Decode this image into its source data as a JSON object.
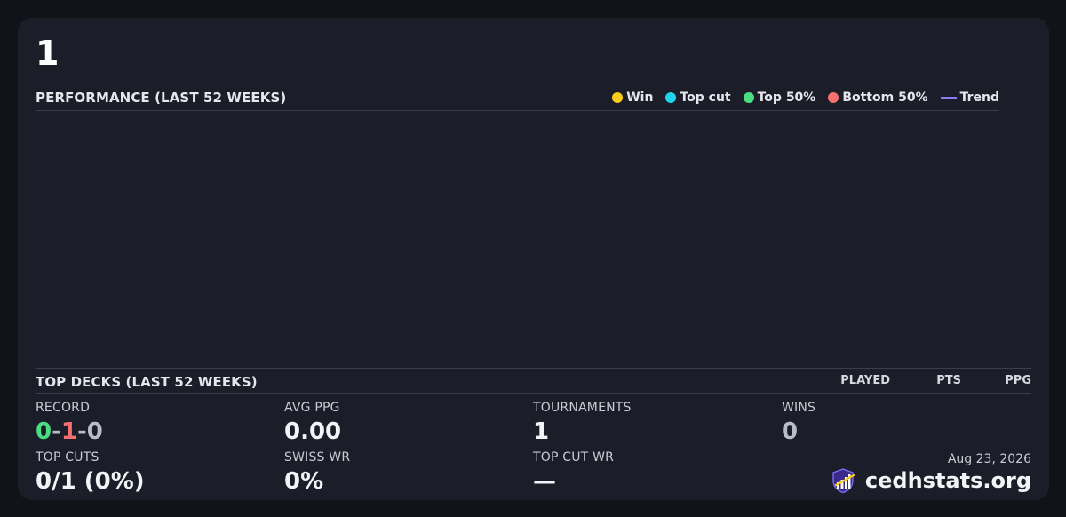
{
  "player": {
    "name": "1"
  },
  "performance": {
    "title": "PERFORMANCE (LAST 52 WEEKS)",
    "legend": [
      {
        "label": "Win",
        "color": "#facc15",
        "kind": "dot"
      },
      {
        "label": "Top cut",
        "color": "#22d3ee",
        "kind": "dot"
      },
      {
        "label": "Top 50%",
        "color": "#4ade80",
        "kind": "dot"
      },
      {
        "label": "Bottom 50%",
        "color": "#f87171",
        "kind": "dot"
      },
      {
        "label": "Trend",
        "color": "#8b7cf6",
        "kind": "line"
      }
    ]
  },
  "top_decks": {
    "title": "TOP DECKS (LAST 52 WEEKS)",
    "columns": [
      "PLAYED",
      "PTS",
      "PPG"
    ]
  },
  "stats": {
    "record": {
      "label": "RECORD",
      "wins": "0",
      "losses": "1",
      "draws": "0"
    },
    "avg_ppg": {
      "label": "AVG PPG",
      "value": "0.00"
    },
    "tournaments": {
      "label": "TOURNAMENTS",
      "value": "1"
    },
    "wins": {
      "label": "WINS",
      "value": "0"
    },
    "top_cuts": {
      "label": "TOP CUTS",
      "value": "0/1 (0%)"
    },
    "swiss_wr": {
      "label": "SWISS WR",
      "value": "0%"
    },
    "top_cut_wr": {
      "label": "TOP CUT WR",
      "value": "—"
    }
  },
  "footer": {
    "date": "Aug 23, 2026",
    "brand": "cedhstats.org",
    "brand_icon": "chart-shield-logo-icon"
  }
}
